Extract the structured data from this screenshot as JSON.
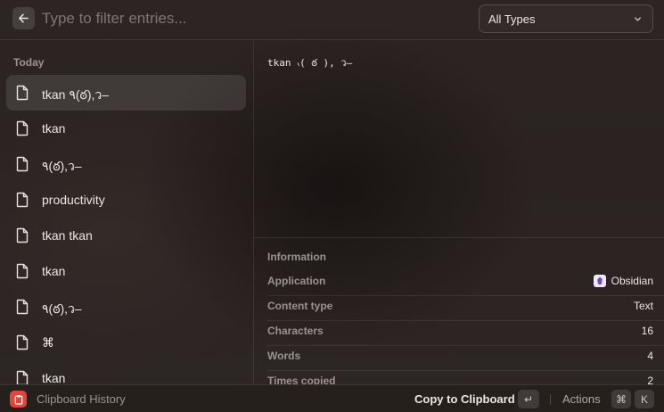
{
  "search": {
    "placeholder": "Type to filter entries..."
  },
  "filter": {
    "selected": "All Types"
  },
  "list": {
    "section": "Today",
    "items": [
      {
        "label": "tkan ٩(ఠ),ว–"
      },
      {
        "label": "tkan"
      },
      {
        "label": "٩(ఠ),ว–"
      },
      {
        "label": "productivity"
      },
      {
        "label": "tkan tkan"
      },
      {
        "label": "tkan"
      },
      {
        "label": "٩(ఠ),ว–"
      },
      {
        "label": "⌘"
      },
      {
        "label": "tkan"
      }
    ]
  },
  "detail": {
    "preview": "tkan ៶( ఠ ), ว–",
    "info_title": "Information",
    "rows": [
      {
        "key": "Application",
        "value": "Obsidian"
      },
      {
        "key": "Content type",
        "value": "Text"
      },
      {
        "key": "Characters",
        "value": "16"
      },
      {
        "key": "Words",
        "value": "4"
      },
      {
        "key": "Times copied",
        "value": "2"
      }
    ]
  },
  "footer": {
    "app_name": "Clipboard History",
    "primary_action": "Copy to Clipboard",
    "primary_key": "↵",
    "actions_label": "Actions",
    "actions_keys": [
      "⌘",
      "K"
    ]
  },
  "colors": {
    "accent_red": "#e2453c",
    "obsidian_purple": "#6a4bc4"
  }
}
